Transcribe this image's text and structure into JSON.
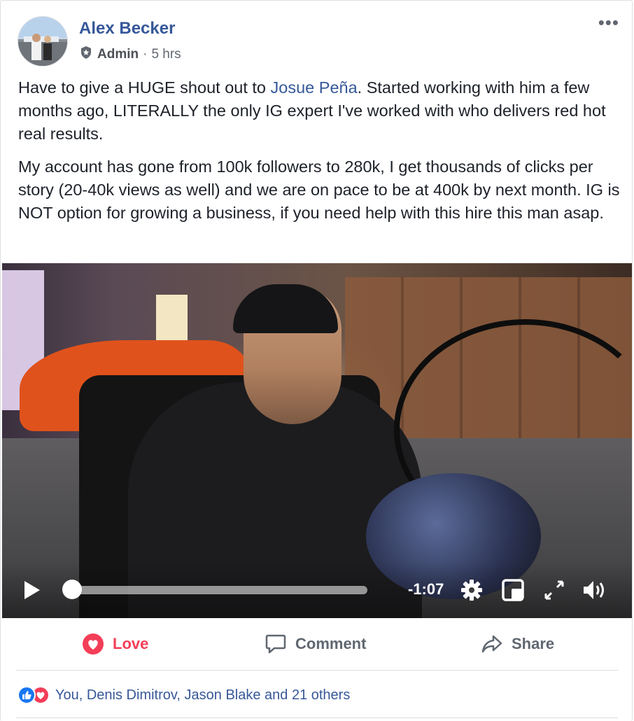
{
  "post": {
    "author": "Alex Becker",
    "role": "Admin",
    "separator": "·",
    "time": "5 hrs",
    "more_label": "•••",
    "paragraph1": {
      "before": "Have to give a HUGE shout out to ",
      "mention": "Josue Peña",
      "after": ". Started working with him a few months ago, LITERALLY the only IG expert I've worked with who delivers red hot real results."
    },
    "paragraph2": "My account has gone from 100k followers to 280k, I get thousands of clicks per story (20-40k views as well) and we are on pace to be at 400k by next month. IG is NOT option for growing a business, if you need help with this hire this man asap."
  },
  "video": {
    "remaining_time": "-1:07",
    "progress": 0.0
  },
  "actions": {
    "love": "Love",
    "comment": "Comment",
    "share": "Share"
  },
  "reactions": {
    "summary": "You, Denis Dimitrov, Jason Blake and 21 others"
  },
  "colors": {
    "link": "#365899",
    "love": "#f33e58",
    "like": "#1877f2",
    "muted": "#606770"
  },
  "icons": [
    "avatar",
    "admin-badge-icon",
    "more-options-icon",
    "play-icon",
    "settings-icon",
    "pip-icon",
    "fullscreen-icon",
    "volume-icon",
    "love-icon",
    "comment-icon",
    "share-icon",
    "like-reaction-icon",
    "love-reaction-icon"
  ]
}
